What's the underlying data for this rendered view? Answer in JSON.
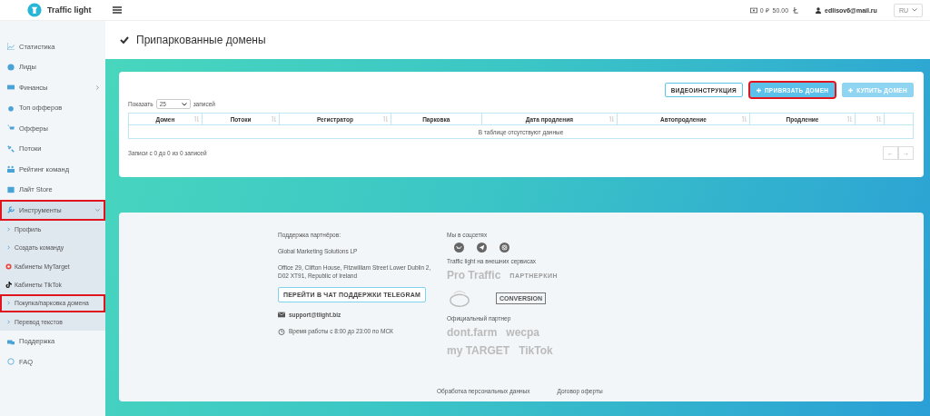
{
  "header": {
    "logo_text": "Traffic light",
    "balance_rub": "0 ₽",
    "balance_points": "50.00",
    "user_email": "edlisov6@mail.ru",
    "language": "RU"
  },
  "sidebar": {
    "items": [
      {
        "label": "Статистика"
      },
      {
        "label": "Лиды"
      },
      {
        "label": "Финансы",
        "has_arrow": true
      },
      {
        "label": "Топ офферов"
      },
      {
        "label": "Офферы"
      },
      {
        "label": "Потоки"
      },
      {
        "label": "Рейтинг команд"
      },
      {
        "label": "Лайт Store"
      },
      {
        "label": "Инструменты",
        "expanded": true,
        "highlighted": true,
        "children": [
          {
            "label": "Профиль",
            "highlighted": false
          },
          {
            "label": "Создать команду",
            "highlighted": false
          },
          {
            "label": "Кабинеты MyTarget",
            "highlighted": false
          },
          {
            "label": "Кабинеты TikTok",
            "highlighted": false
          },
          {
            "label": "Покупка/парковка домена",
            "highlighted": true
          },
          {
            "label": "Перевод текстов",
            "highlighted": false
          }
        ]
      },
      {
        "label": "Поддержка"
      },
      {
        "label": "FAQ"
      }
    ]
  },
  "page_title": "Припаркованные домены",
  "buttons": [
    {
      "label": "ВИДЕОИНСТРУКЦИЯ",
      "kind": "outline",
      "highlighted": false
    },
    {
      "label": "ПРИВЯЗАТЬ ДОМЕН",
      "kind": "primary",
      "highlighted": true
    },
    {
      "label": "КУПИТЬ ДОМЕН",
      "kind": "light",
      "highlighted": false
    }
  ],
  "table": {
    "show_label": "Показать",
    "page_size": "25",
    "records_label": "записей",
    "columns": [
      {
        "label": "Домен",
        "sortable": true
      },
      {
        "label": "Потоки",
        "sortable": true
      },
      {
        "label": "Регистратор",
        "sortable": true
      },
      {
        "label": "Парковка",
        "sortable": false
      },
      {
        "label": "Дата продления",
        "sortable": true
      },
      {
        "label": "Автопродление",
        "sortable": true
      },
      {
        "label": "Продление",
        "sortable": true
      },
      {
        "sortable": true
      },
      {
        "sortable": false
      }
    ],
    "empty_text": "В таблице отсутствуют данные",
    "info": "Записи с 0 до 0 из 0 записей",
    "pager": [
      "←",
      "→"
    ]
  },
  "footer": {
    "support_title": "Поддержка партнёров:",
    "company": "Global Marketing Solutions LP",
    "address": "Office 29, Clifton House, Fitzwilliam Street Lower Dublin 2, D02 XT91, Republic of Ireland",
    "telegram_button": "ПЕРЕЙТИ В ЧАТ ПОДДЕРЖКИ TELEGRAM",
    "email": "support@tlight.biz",
    "hours": "Время работы с 8:00 до 23:00 по МСК",
    "social_title": "Мы в соцсетях",
    "services_title": "Traffic light на внешних сервисах",
    "services": [
      "Pro Traffic",
      "ПАРТНЕРКИН",
      "CONVERSION"
    ],
    "partner_title": "Официальный партнер",
    "partners": [
      "dont.farm",
      "wecpa",
      "my TARGET",
      "TikTok"
    ],
    "links": [
      "Обработка персональных данных",
      "Договор оферты"
    ]
  }
}
